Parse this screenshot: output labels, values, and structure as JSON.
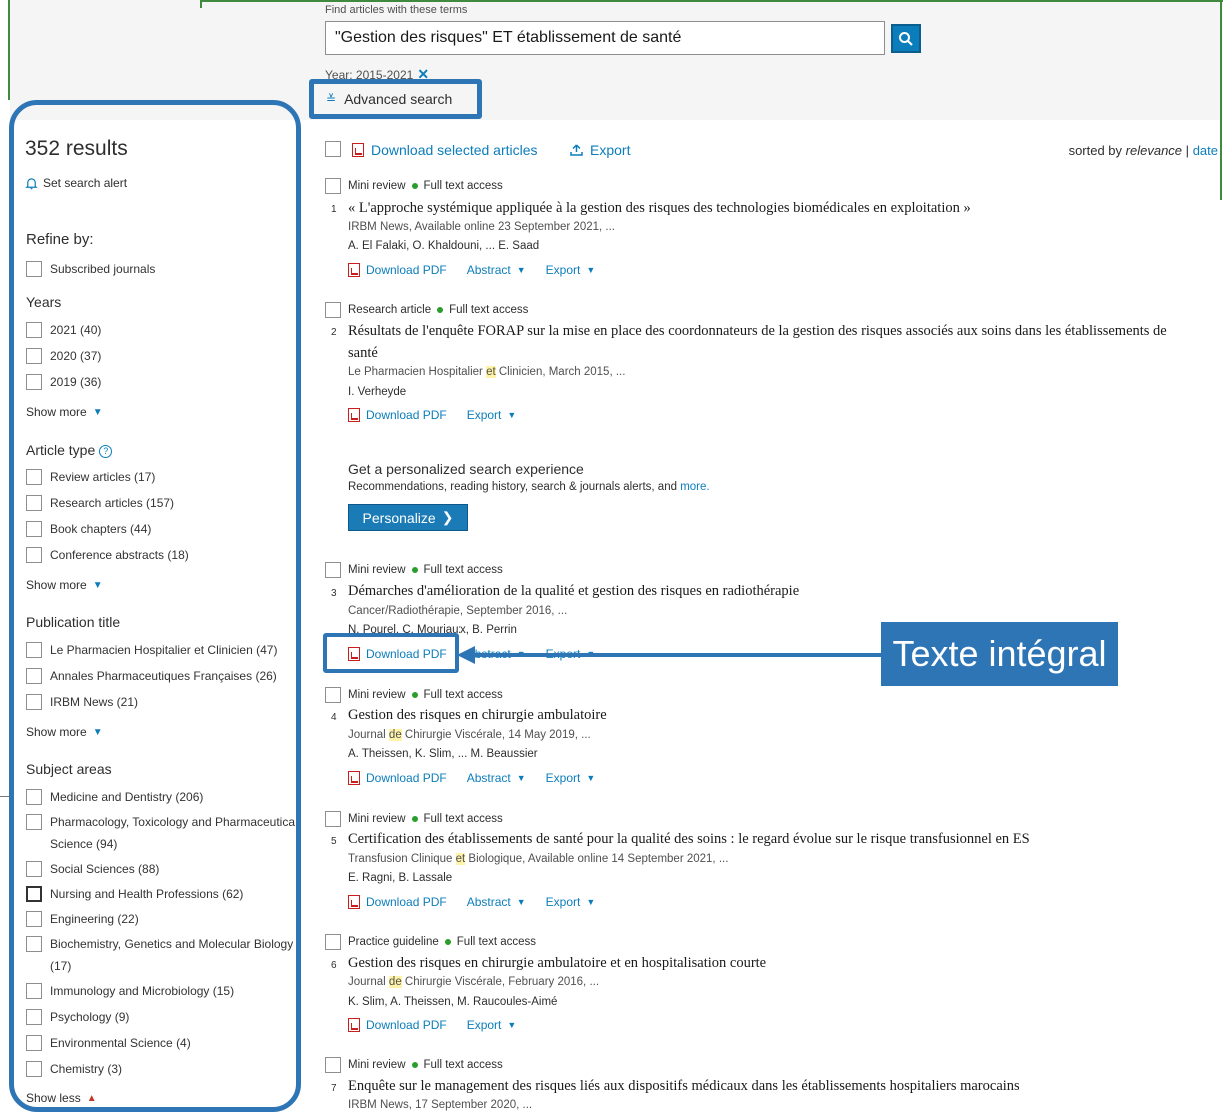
{
  "search": {
    "find_label": "Find articles with these terms",
    "query": "\"Gestion des risques\" ET établissement de santé",
    "year_filter": "Year: 2015-2021",
    "advanced_label": "Advanced search"
  },
  "sidebar": {
    "results_count": "352 results",
    "alert_label": "Set search alert",
    "refine_label": "Refine by:",
    "subscribed": "Subscribed journals",
    "years_head": "Years",
    "years": [
      "2021 (40)",
      "2020 (37)",
      "2019 (36)"
    ],
    "show_more": "Show more",
    "show_less": "Show less",
    "article_type_head": "Article type",
    "article_types": [
      "Review articles (17)",
      "Research articles (157)",
      "Book chapters (44)",
      "Conference abstracts (18)"
    ],
    "publication_head": "Publication title",
    "publications": [
      "Le Pharmacien Hospitalier et Clinicien (47)",
      "Annales Pharmaceutiques Françaises (26)",
      "IRBM News (21)"
    ],
    "subject_head": "Subject areas",
    "subjects": [
      "Medicine and Dentistry (206)",
      "Pharmacology, Toxicology and Pharmaceutica",
      "Science (94)",
      "Social Sciences (88)",
      "Nursing and Health Professions (62)",
      "Engineering (22)",
      "Biochemistry, Genetics and Molecular Biology",
      "(17)",
      "Immunology and Microbiology (15)",
      "Psychology (9)",
      "Environmental Science (4)",
      "Chemistry (3)"
    ]
  },
  "toolbar": {
    "download_selected": "Download selected articles",
    "export": "Export",
    "sorted_by": "sorted by",
    "relevance": "relevance",
    "sep": "|",
    "date": "date"
  },
  "actions": {
    "download_pdf": "Download PDF",
    "abstract": "Abstract",
    "export": "Export"
  },
  "access": "Full text access",
  "results": [
    {
      "type": "Mini review",
      "num": "1",
      "title": "« L'approche systémique appliquée à la gestion des risques des technologies biomédicales en exploitation »",
      "source": "IRBM News, Available online 23 September 2021, ...",
      "authors": "A. El Falaki, O. Khaldouni, ... E. Saad"
    },
    {
      "type": "Research article",
      "num": "2",
      "title_1": "Résultats de l'enquête FORAP sur la mise en place des coordonnateurs de la gestion des risques associés aux soins dans les établissements de",
      "title_2": "santé",
      "source_a": "Le Pharmacien Hospitalier",
      "source_hl": "et",
      "source_b": "Clinicien, March 2015, ...",
      "authors": "I. Verheyde"
    },
    {
      "type": "Mini review",
      "num": "3",
      "title": "Démarches d'amélioration de la qualité et gestion des risques en radiothérapie",
      "source": "Cancer/Radiothérapie, September 2016, ...",
      "authors_a": "N. Pourel, C. Mouriaux",
      "authors_b": "x, B. Perrin"
    },
    {
      "type": "Mini review",
      "num": "4",
      "title": "Gestion des risques en chirurgie ambulatoire",
      "source_a": "Journal",
      "source_hl": "de",
      "source_b": "Chirurgie Viscérale, 14 May 2019, ...",
      "authors": "A. Theissen, K. Slim, ... M. Beaussier"
    },
    {
      "type": "Mini review",
      "num": "5",
      "title": "Certification des établissements de santé pour la qualité des soins : le regard évolue sur le risque transfusionnel en ES",
      "source_a": "Transfusion Clinique",
      "source_hl": "et",
      "source_b": "Biologique, Available online 14 September 2021, ...",
      "authors": "E. Ragni, B. Lassale"
    },
    {
      "type": "Practice guideline",
      "num": "6",
      "title": "Gestion des risques en chirurgie ambulatoire et en hospitalisation courte",
      "source_a": "Journal",
      "source_hl": "de",
      "source_b": "Chirurgie Viscérale, February 2016, ...",
      "authors": "K. Slim, A. Theissen, M. Raucoules-Aimé"
    },
    {
      "type": "Mini review",
      "num": "7",
      "title": "Enquête sur le management des risques liés aux dispositifs médicaux dans les établissements hospitaliers marocains",
      "source": "IRBM News, 17 September 2020, ..."
    }
  ],
  "personalize": {
    "heading": "Get a personalized search experience",
    "sub": "Recommendations, reading history, search & journals alerts, and",
    "more": "more.",
    "button": "Personalize"
  },
  "callout": "Texte intégral",
  "colors": {
    "accent": "#0c7dbb",
    "annotation": "#2e75b6",
    "open_access": "#2a9d2a",
    "highlight": "#fff3a8"
  }
}
